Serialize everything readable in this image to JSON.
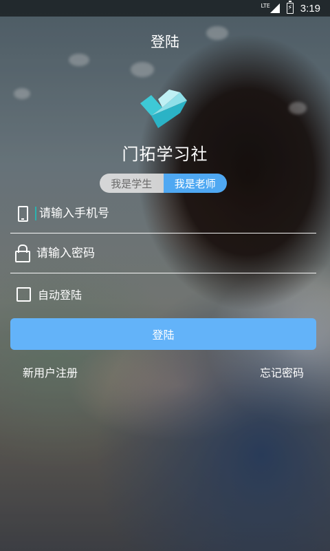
{
  "status_bar": {
    "network": "LTE",
    "time": "3:19"
  },
  "header": {
    "title": "登陆"
  },
  "app": {
    "name": "门拓学习社"
  },
  "role_toggle": {
    "student": "我是学生",
    "teacher": "我是老师",
    "selected": "teacher"
  },
  "form": {
    "phone_placeholder": "请输入手机号",
    "password_placeholder": "请输入密码",
    "auto_login_label": "自动登陆",
    "auto_login_checked": false
  },
  "actions": {
    "login": "登陆",
    "register": "新用户注册",
    "forgot": "忘记密码"
  },
  "colors": {
    "accent": "#63b3f9",
    "toggle_active": "#4fa8f2",
    "logo": "#3ec9d6"
  }
}
